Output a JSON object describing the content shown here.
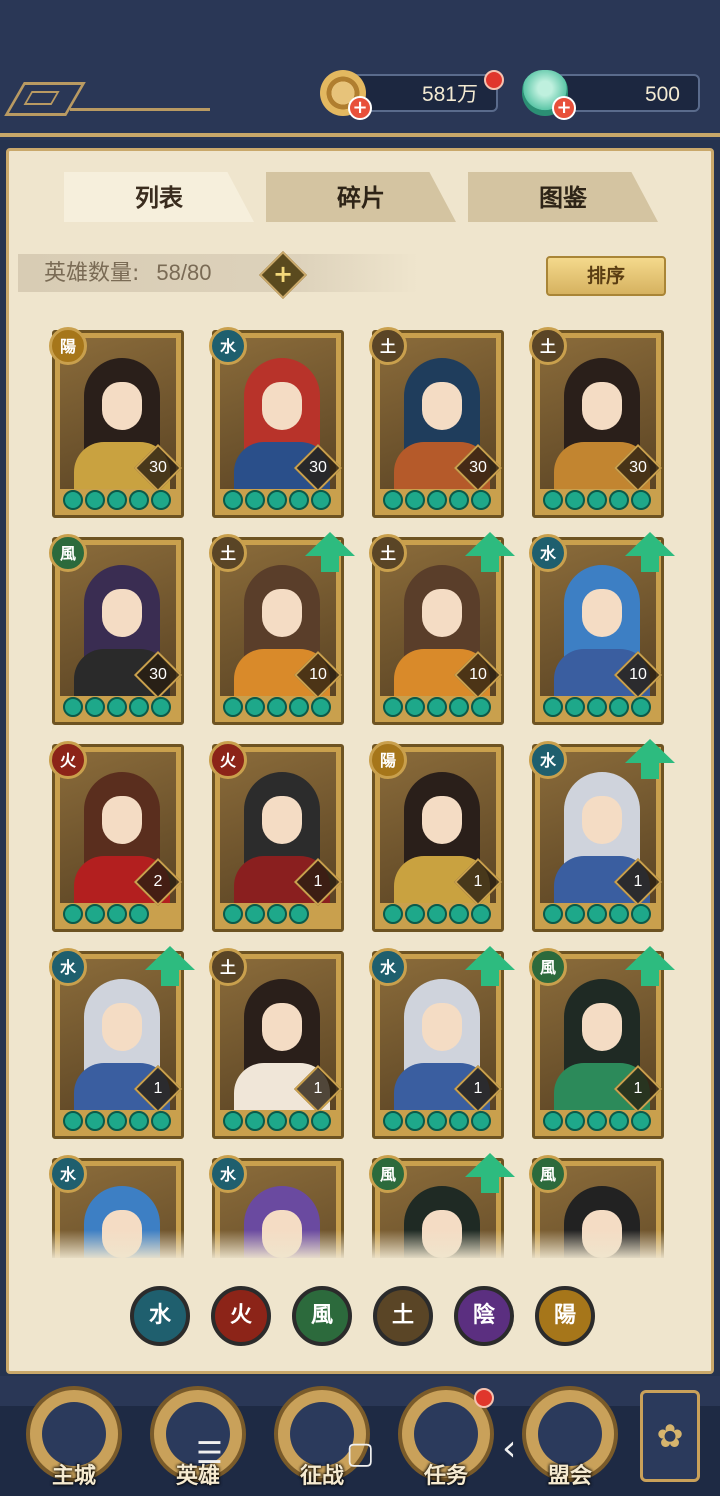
{
  "header": {
    "gold_value": "581万",
    "jade_value": "500"
  },
  "tabs": [
    {
      "label": "列表",
      "active": true
    },
    {
      "label": "碎片",
      "active": false
    },
    {
      "label": "图鉴",
      "active": false
    }
  ],
  "hero_count": {
    "label": "英雄数量:",
    "value": "58/80"
  },
  "sort_button": "排序",
  "elements": {
    "water": {
      "glyph": "水",
      "color": "#1f5f6e"
    },
    "fire": {
      "glyph": "火",
      "color": "#8c2418"
    },
    "wind": {
      "glyph": "風",
      "color": "#2c6a3c"
    },
    "earth": {
      "glyph": "土",
      "color": "#5a4526"
    },
    "yin": {
      "glyph": "陰",
      "color": "#5b2f80"
    },
    "yang": {
      "glyph": "陽",
      "color": "#a6761a"
    }
  },
  "heroes": [
    {
      "element": "陽",
      "elem_color": "#a6761a",
      "level": "30",
      "stars": 5,
      "upgrade": false
    },
    {
      "element": "水",
      "elem_color": "#1f5f6e",
      "level": "30",
      "stars": 5,
      "upgrade": false
    },
    {
      "element": "土",
      "elem_color": "#5a4526",
      "level": "30",
      "stars": 5,
      "upgrade": false
    },
    {
      "element": "土",
      "elem_color": "#5a4526",
      "level": "30",
      "stars": 5,
      "upgrade": false
    },
    {
      "element": "風",
      "elem_color": "#2c6a3c",
      "level": "30",
      "stars": 5,
      "upgrade": false
    },
    {
      "element": "土",
      "elem_color": "#5a4526",
      "level": "10",
      "stars": 5,
      "upgrade": true
    },
    {
      "element": "土",
      "elem_color": "#5a4526",
      "level": "10",
      "stars": 5,
      "upgrade": true
    },
    {
      "element": "水",
      "elem_color": "#1f5f6e",
      "level": "10",
      "stars": 5,
      "upgrade": true
    },
    {
      "element": "火",
      "elem_color": "#8c2418",
      "level": "2",
      "stars": 4,
      "upgrade": false
    },
    {
      "element": "火",
      "elem_color": "#8c2418",
      "level": "1",
      "stars": 4,
      "upgrade": false
    },
    {
      "element": "陽",
      "elem_color": "#a6761a",
      "level": "1",
      "stars": 5,
      "upgrade": false
    },
    {
      "element": "水",
      "elem_color": "#1f5f6e",
      "level": "1",
      "stars": 5,
      "upgrade": true
    },
    {
      "element": "水",
      "elem_color": "#1f5f6e",
      "level": "1",
      "stars": 5,
      "upgrade": true
    },
    {
      "element": "土",
      "elem_color": "#5a4526",
      "level": "1",
      "stars": 5,
      "upgrade": false
    },
    {
      "element": "水",
      "elem_color": "#1f5f6e",
      "level": "1",
      "stars": 5,
      "upgrade": true
    },
    {
      "element": "風",
      "elem_color": "#2c6a3c",
      "level": "1",
      "stars": 5,
      "upgrade": true
    },
    {
      "element": "水",
      "elem_color": "#1f5f6e",
      "level": "",
      "stars": 0,
      "upgrade": false
    },
    {
      "element": "水",
      "elem_color": "#1f5f6e",
      "level": "",
      "stars": 0,
      "upgrade": false
    },
    {
      "element": "風",
      "elem_color": "#2c6a3c",
      "level": "",
      "stars": 0,
      "upgrade": true
    },
    {
      "element": "風",
      "elem_color": "#2c6a3c",
      "level": "",
      "stars": 0,
      "upgrade": false
    }
  ],
  "filters": [
    {
      "glyph": "水",
      "color": "#1f5f6e"
    },
    {
      "glyph": "火",
      "color": "#8c2418"
    },
    {
      "glyph": "風",
      "color": "#2c6a3c"
    },
    {
      "glyph": "土",
      "color": "#5a4526"
    },
    {
      "glyph": "陰",
      "color": "#5b2f80"
    },
    {
      "glyph": "陽",
      "color": "#a6761a"
    }
  ],
  "bottom_nav": [
    {
      "label": "主城"
    },
    {
      "label": "英雄"
    },
    {
      "label": "征战"
    },
    {
      "label": "任务"
    },
    {
      "label": "盟会"
    }
  ],
  "system_nav": {
    "menu": "☰",
    "home": "▢",
    "back": "‹"
  }
}
